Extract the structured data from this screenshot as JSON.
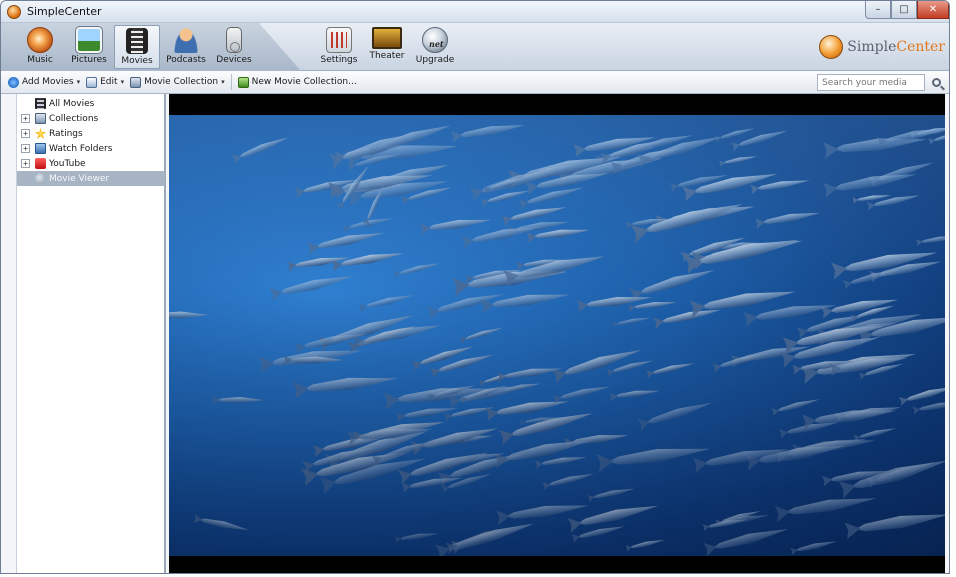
{
  "window": {
    "title": "SimpleCenter",
    "minimize_glyph": "–",
    "maximize_glyph": "□",
    "close_glyph": "✕"
  },
  "nav": {
    "items": [
      {
        "label": "Music",
        "icon": "music-icon"
      },
      {
        "label": "Pictures",
        "icon": "pictures-icon"
      },
      {
        "label": "Movies",
        "icon": "movies-icon",
        "active": true
      },
      {
        "label": "Podcasts",
        "icon": "podcasts-icon"
      },
      {
        "label": "Devices",
        "icon": "devices-icon"
      },
      {
        "label": "Settings",
        "icon": "settings-icon"
      },
      {
        "label": "Theater",
        "icon": "theater-icon"
      },
      {
        "label": "Upgrade",
        "icon": "upgrade-icon"
      }
    ],
    "brand_simple": "Simple",
    "brand_center": "Center"
  },
  "toolbar": {
    "add_movies": "Add Movies",
    "edit": "Edit",
    "movie_collection": "Movie Collection",
    "new_movie_collection": "New Movie Collection...",
    "caret": "▾",
    "search_placeholder": "Search your media"
  },
  "sidebar": {
    "items": [
      {
        "label": "All Movies",
        "expandable": false
      },
      {
        "label": "Collections",
        "expandable": true
      },
      {
        "label": "Ratings",
        "expandable": true
      },
      {
        "label": "Watch Folders",
        "expandable": true
      },
      {
        "label": "YouTube",
        "expandable": true
      },
      {
        "label": "Movie Viewer",
        "expandable": false,
        "selected": true
      }
    ],
    "expander_glyph": "+"
  },
  "colors": {
    "accent_orange": "#e0781c",
    "selection": "#a7b4c4",
    "ocean": "#1d5ea8"
  }
}
